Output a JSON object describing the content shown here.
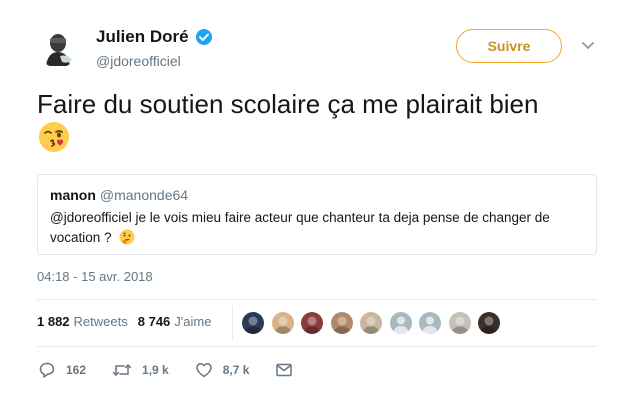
{
  "author": {
    "display_name": "Julien Doré",
    "handle": "@jdoreofficiel",
    "verified": true
  },
  "follow_button": {
    "label": "Suivre"
  },
  "tweet": {
    "text": "Faire du soutien scolaire ça me plairait bien",
    "emoji": "winking-kiss-emoji"
  },
  "quote": {
    "display_name": "manon",
    "handle": "@manonde64",
    "text": "@jdoreofficiel  je le vois mieu faire acteur que chanteur  ta deja pense de changer de vocation ?",
    "emoji": "thinking-face-emoji"
  },
  "timestamp": "04:18 - 15 avr. 2018",
  "stats": {
    "retweets_count": "1 882",
    "retweets_label": "Retweets",
    "likes_count": "8 746",
    "likes_label": "J'aime"
  },
  "liker_avatars": [
    "#2b3a55",
    "#d8b48a",
    "#8a3b3b",
    "#b08a6a",
    "#c9b7a0",
    "#aab8c2",
    "#aab8c2",
    "#c7c0b8",
    "#3a2f2a"
  ],
  "actions": {
    "replies": "162",
    "retweets": "1,9 k",
    "likes": "8,7 k"
  },
  "colors": {
    "accent": "#f5a623",
    "muted": "#657786",
    "text": "#14171a",
    "verified": "#1da1f2"
  }
}
